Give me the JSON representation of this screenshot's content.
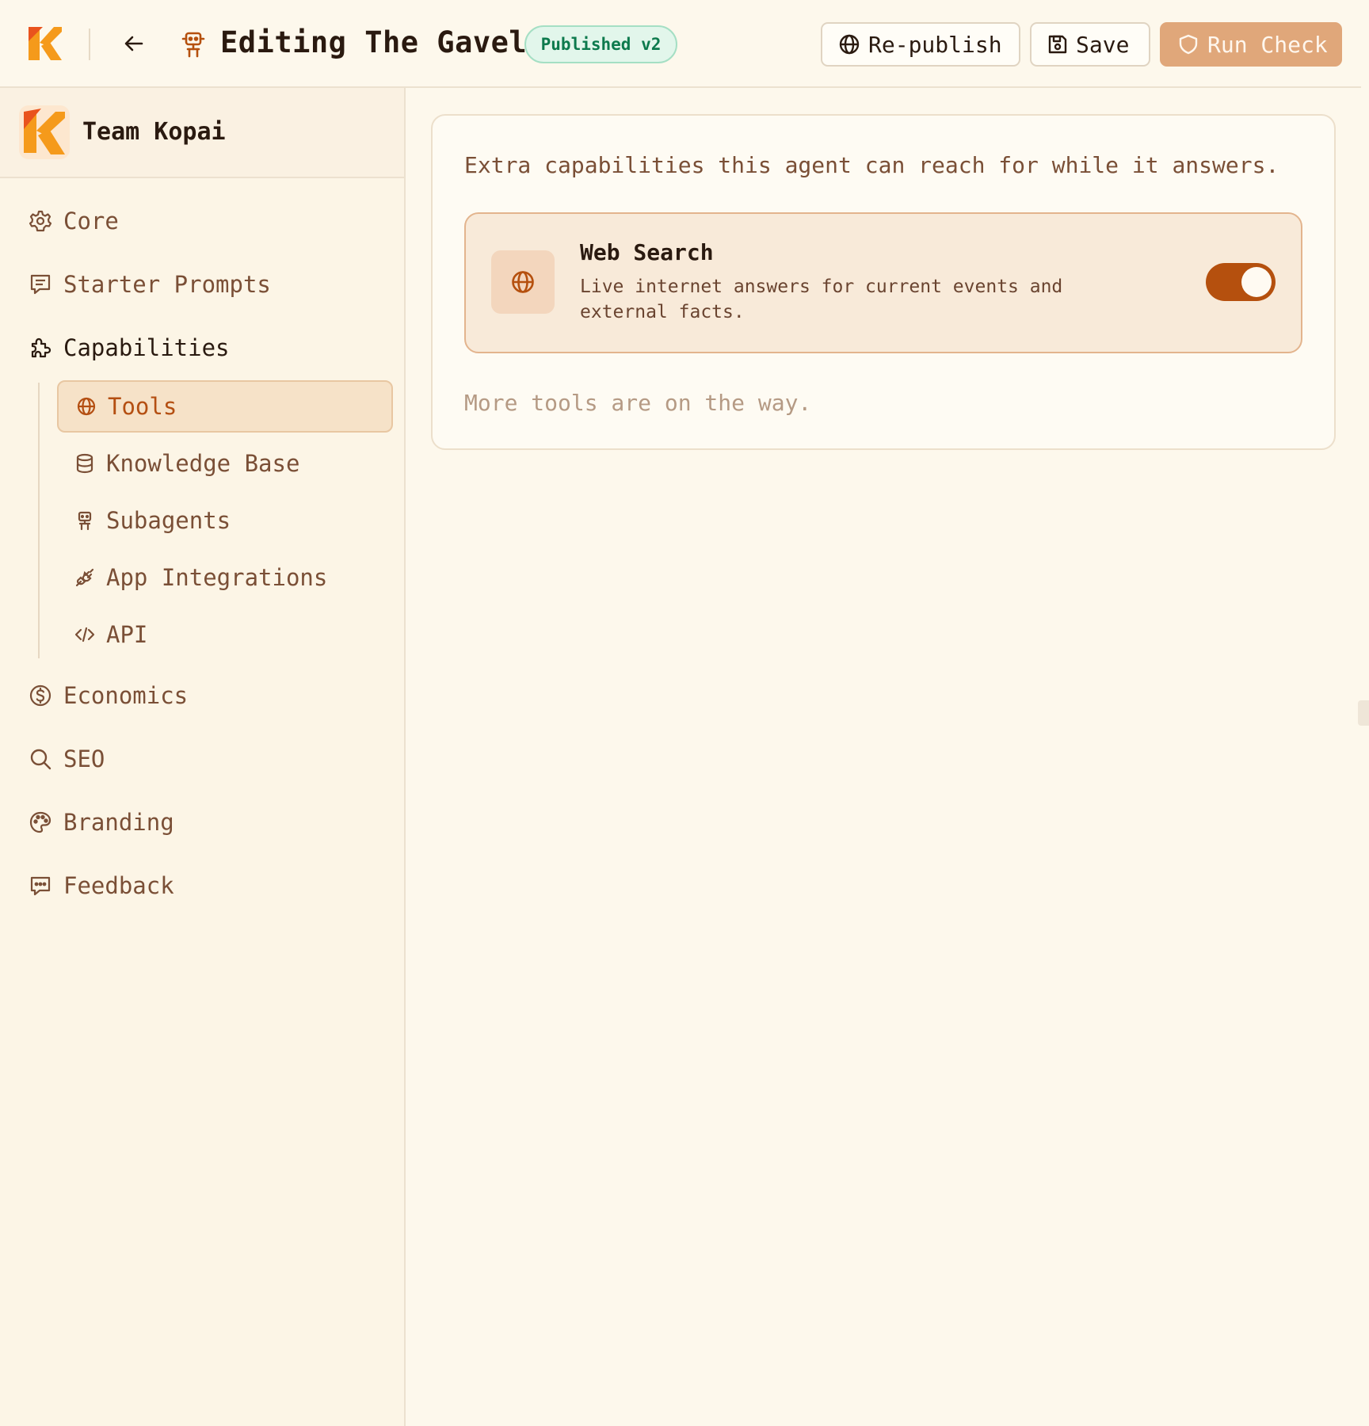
{
  "header": {
    "title": "Editing The Gavel",
    "status_badge": "Published v2",
    "republish_label": "Re-publish",
    "save_label": "Save",
    "run_check_label": "Run Check"
  },
  "sidebar": {
    "team_name": "Team Kopai",
    "items": [
      {
        "label": "Core",
        "icon": "gear-icon"
      },
      {
        "label": "Starter Prompts",
        "icon": "message-square-icon"
      },
      {
        "label": "Capabilities",
        "icon": "puzzle-icon"
      },
      {
        "label": "Economics",
        "icon": "dollar-circle-icon"
      },
      {
        "label": "SEO",
        "icon": "search-icon"
      },
      {
        "label": "Branding",
        "icon": "palette-icon"
      },
      {
        "label": "Feedback",
        "icon": "chat-bubble-icon"
      }
    ],
    "capabilities_sub": [
      {
        "label": "Tools",
        "icon": "globe-icon",
        "selected": true
      },
      {
        "label": "Knowledge Base",
        "icon": "database-icon"
      },
      {
        "label": "Subagents",
        "icon": "robot-icon"
      },
      {
        "label": "App Integrations",
        "icon": "plug-icon"
      },
      {
        "label": "API",
        "icon": "code-icon"
      }
    ]
  },
  "main": {
    "description": "Extra capabilities this agent can reach for while it answers.",
    "tool": {
      "name": "Web Search",
      "description": "Live internet answers for current events and external facts.",
      "enabled": true,
      "icon": "globe-icon"
    },
    "more_note": "More tools are on the way."
  },
  "colors": {
    "accent": "#b5500e",
    "background": "#fdf8ec",
    "badge_green": "#0d7a4d",
    "run_check_bg": "#e0a77a"
  }
}
